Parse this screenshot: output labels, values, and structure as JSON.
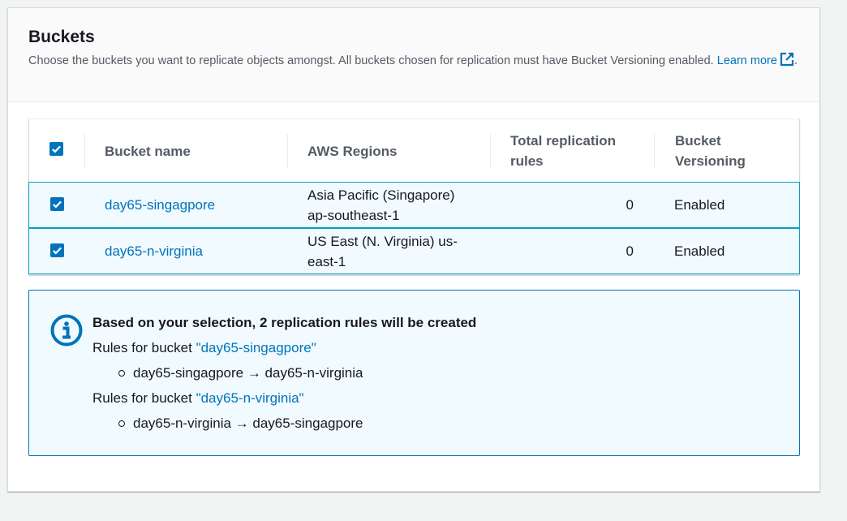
{
  "section": {
    "title": "Buckets",
    "description": "Choose the buckets you want to replicate objects amongst. All buckets chosen for replication must have Bucket Versioning enabled.",
    "learn_more": "Learn more",
    "learn_more_suffix": "."
  },
  "table": {
    "columns": [
      "Bucket name",
      "AWS Regions",
      "Total replication rules",
      "Bucket Versioning"
    ],
    "select_all_checked": true,
    "rows": [
      {
        "checked": true,
        "bucket_name": "day65-singagpore",
        "region_line1": "Asia Pacific (Singapore)",
        "region_line2": "ap-southeast-1",
        "total_rules": "0",
        "versioning": "Enabled"
      },
      {
        "checked": true,
        "bucket_name": "day65-n-virginia",
        "region_line1": "US East (N. Virginia) us-",
        "region_line2": "east-1",
        "total_rules": "0",
        "versioning": "Enabled"
      }
    ]
  },
  "alert": {
    "icon": "info-icon",
    "title": "Based on your selection, 2 replication rules will be created",
    "groups": [
      {
        "prefix": "Rules for bucket ",
        "bucket": "\"day65-singagpore\"",
        "rule": "day65-singagpore → day65-n-virginia"
      },
      {
        "prefix": "Rules for bucket ",
        "bucket": "\"day65-n-virginia\"",
        "rule": "day65-n-virginia → day65-singagpore"
      }
    ]
  },
  "colors": {
    "link": "#0073bb",
    "selected_row_bg": "#f1faff",
    "selected_row_border": "#00a1c9",
    "checkbox": "#0073bb"
  }
}
